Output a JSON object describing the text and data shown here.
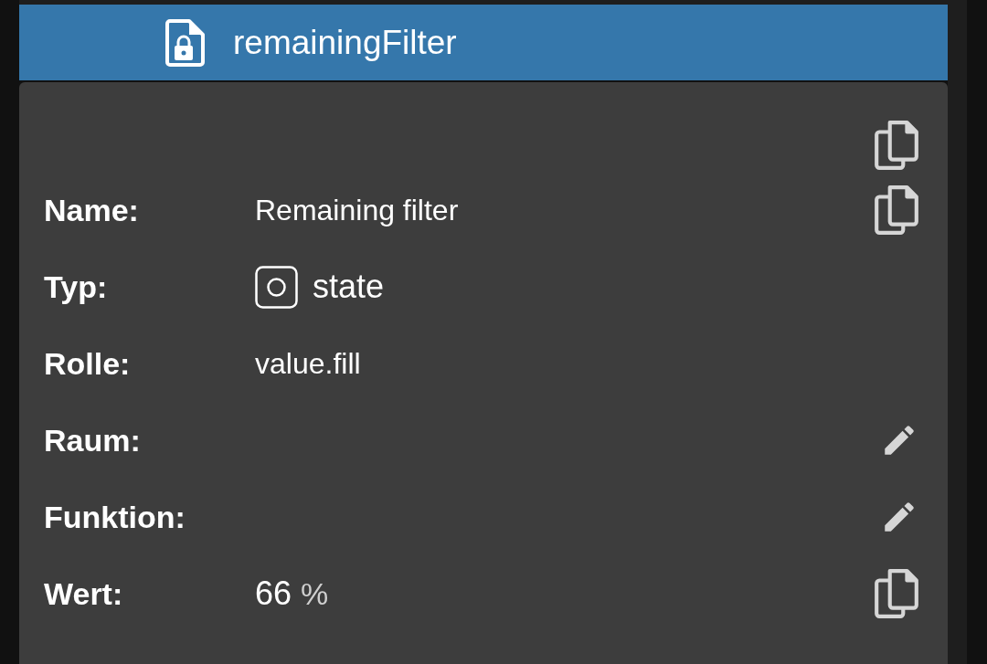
{
  "header": {
    "title": "remainingFilter"
  },
  "card": {
    "copy_all": true,
    "rows": [
      {
        "label": "Name:",
        "value": "Remaining filter",
        "kind": "text",
        "copyable": true,
        "editable": false
      },
      {
        "label": "Typ:",
        "value": "state",
        "kind": "type",
        "copyable": false,
        "editable": false
      },
      {
        "label": "Rolle:",
        "value": "value.fill",
        "kind": "text",
        "copyable": false,
        "editable": false
      },
      {
        "label": "Raum:",
        "kind": "empty",
        "copyable": false,
        "editable": true
      },
      {
        "label": "Funktion:",
        "kind": "empty",
        "copyable": false,
        "editable": true
      },
      {
        "label": "Wert:",
        "value": "66",
        "unit": "%",
        "kind": "unit",
        "copyable": true,
        "editable": false
      }
    ]
  }
}
